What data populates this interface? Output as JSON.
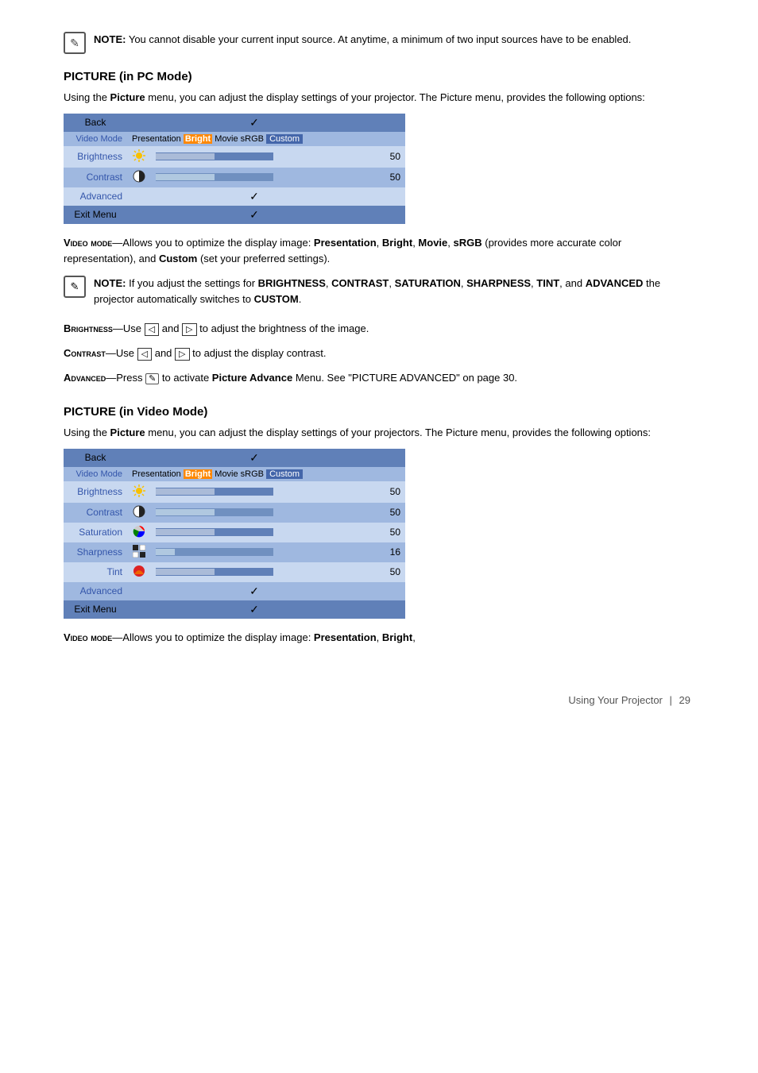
{
  "note1": {
    "label": "NOTE:",
    "text": "You cannot disable your current input source. At anytime, a minimum of two input sources have to be enabled."
  },
  "section_pc": {
    "heading": "PICTURE (in PC Mode)",
    "intro": "Using the Picture menu, you can adjust the display settings of your projector. The Picture menu, provides the following options:",
    "menu": {
      "back_label": "Back",
      "back_check": "✓",
      "header_label": "Video Mode",
      "modes": [
        "Presentation",
        "Bright",
        "Movie",
        "sRGB",
        "Custom"
      ],
      "highlight_mode": "Bright",
      "rows": [
        {
          "label": "Brightness",
          "icon": "sun",
          "bar": 50,
          "value": "50"
        },
        {
          "label": "Contrast",
          "icon": "half-circle",
          "bar": 50,
          "value": "50"
        },
        {
          "label": "Advanced",
          "icon": "",
          "check": "✓",
          "value": ""
        },
        {
          "label": "Exit Menu",
          "icon": "",
          "check": "✓",
          "value": ""
        }
      ]
    }
  },
  "video_mode_desc": {
    "term": "VIDEO MODE",
    "text": "—Allows you to optimize the display image: ",
    "items": "Presentation, Bright, Movie, sRGB (provides more accurate color representation), and Custom (set your preferred settings)."
  },
  "note2": {
    "label": "NOTE:",
    "text": "If you adjust the settings for Brightness, Contrast, Saturation, Sharpness, Tint, and Advanced the projector automatically switches to Custom."
  },
  "brightness_desc": {
    "term": "BRIGHTNESS",
    "text": "—Use ◁ and ▷ to adjust the brightness of the image."
  },
  "contrast_desc": {
    "term": "CONTRAST",
    "text": "—Use ◁ and ▷ to adjust the display contrast."
  },
  "advanced_desc": {
    "term": "ADVANCED",
    "text": "—Press  to activate Picture Advance Menu. See \"PICTURE ADVANCED\" on page 30."
  },
  "section_video": {
    "heading": "PICTURE (in Video Mode)",
    "intro": "Using the Picture menu, you can adjust the display settings of your projectors. The Picture menu, provides the following options:",
    "menu": {
      "back_label": "Back",
      "back_check": "✓",
      "header_label": "Video Mode",
      "modes": [
        "Presentation",
        "Bright",
        "Movie",
        "sRGB",
        "Custom"
      ],
      "highlight_mode": "Bright",
      "rows": [
        {
          "label": "Brightness",
          "icon": "sun",
          "bar": 50,
          "value": "50"
        },
        {
          "label": "Contrast",
          "icon": "half-circle",
          "bar": 50,
          "value": "50"
        },
        {
          "label": "Saturation",
          "icon": "color-wheel",
          "bar": 50,
          "value": "50"
        },
        {
          "label": "Sharpness",
          "icon": "sharp",
          "bar": 16,
          "value": "16"
        },
        {
          "label": "Tint",
          "icon": "tint",
          "bar": 50,
          "value": "50"
        },
        {
          "label": "Advanced",
          "icon": "",
          "check": "✓",
          "value": ""
        },
        {
          "label": "Exit Menu",
          "icon": "",
          "check": "✓",
          "value": ""
        }
      ]
    }
  },
  "video_mode_desc2": {
    "term": "VIDEO MODE",
    "text": "—Allows you to optimize the display image: Presentation, Bright,"
  },
  "footer": {
    "text": "Using Your Projector",
    "separator": "|",
    "page": "29"
  }
}
